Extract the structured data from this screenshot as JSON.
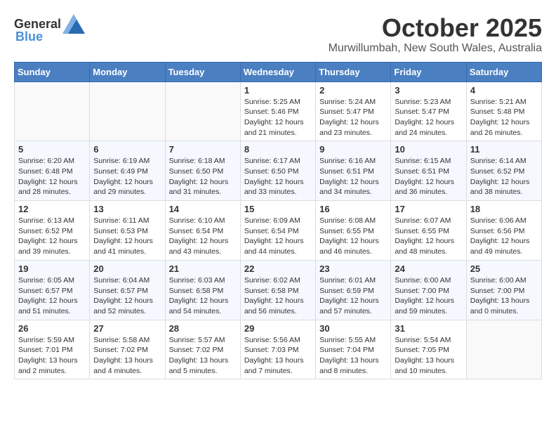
{
  "logo": {
    "general": "General",
    "blue": "Blue"
  },
  "title": "October 2025",
  "location": "Murwillumbah, New South Wales, Australia",
  "weekdays": [
    "Sunday",
    "Monday",
    "Tuesday",
    "Wednesday",
    "Thursday",
    "Friday",
    "Saturday"
  ],
  "weeks": [
    [
      {
        "day": "",
        "info": ""
      },
      {
        "day": "",
        "info": ""
      },
      {
        "day": "",
        "info": ""
      },
      {
        "day": "1",
        "info": "Sunrise: 5:25 AM\nSunset: 5:46 PM\nDaylight: 12 hours\nand 21 minutes."
      },
      {
        "day": "2",
        "info": "Sunrise: 5:24 AM\nSunset: 5:47 PM\nDaylight: 12 hours\nand 23 minutes."
      },
      {
        "day": "3",
        "info": "Sunrise: 5:23 AM\nSunset: 5:47 PM\nDaylight: 12 hours\nand 24 minutes."
      },
      {
        "day": "4",
        "info": "Sunrise: 5:21 AM\nSunset: 5:48 PM\nDaylight: 12 hours\nand 26 minutes."
      }
    ],
    [
      {
        "day": "5",
        "info": "Sunrise: 6:20 AM\nSunset: 6:48 PM\nDaylight: 12 hours\nand 28 minutes."
      },
      {
        "day": "6",
        "info": "Sunrise: 6:19 AM\nSunset: 6:49 PM\nDaylight: 12 hours\nand 29 minutes."
      },
      {
        "day": "7",
        "info": "Sunrise: 6:18 AM\nSunset: 6:50 PM\nDaylight: 12 hours\nand 31 minutes."
      },
      {
        "day": "8",
        "info": "Sunrise: 6:17 AM\nSunset: 6:50 PM\nDaylight: 12 hours\nand 33 minutes."
      },
      {
        "day": "9",
        "info": "Sunrise: 6:16 AM\nSunset: 6:51 PM\nDaylight: 12 hours\nand 34 minutes."
      },
      {
        "day": "10",
        "info": "Sunrise: 6:15 AM\nSunset: 6:51 PM\nDaylight: 12 hours\nand 36 minutes."
      },
      {
        "day": "11",
        "info": "Sunrise: 6:14 AM\nSunset: 6:52 PM\nDaylight: 12 hours\nand 38 minutes."
      }
    ],
    [
      {
        "day": "12",
        "info": "Sunrise: 6:13 AM\nSunset: 6:52 PM\nDaylight: 12 hours\nand 39 minutes."
      },
      {
        "day": "13",
        "info": "Sunrise: 6:11 AM\nSunset: 6:53 PM\nDaylight: 12 hours\nand 41 minutes."
      },
      {
        "day": "14",
        "info": "Sunrise: 6:10 AM\nSunset: 6:54 PM\nDaylight: 12 hours\nand 43 minutes."
      },
      {
        "day": "15",
        "info": "Sunrise: 6:09 AM\nSunset: 6:54 PM\nDaylight: 12 hours\nand 44 minutes."
      },
      {
        "day": "16",
        "info": "Sunrise: 6:08 AM\nSunset: 6:55 PM\nDaylight: 12 hours\nand 46 minutes."
      },
      {
        "day": "17",
        "info": "Sunrise: 6:07 AM\nSunset: 6:55 PM\nDaylight: 12 hours\nand 48 minutes."
      },
      {
        "day": "18",
        "info": "Sunrise: 6:06 AM\nSunset: 6:56 PM\nDaylight: 12 hours\nand 49 minutes."
      }
    ],
    [
      {
        "day": "19",
        "info": "Sunrise: 6:05 AM\nSunset: 6:57 PM\nDaylight: 12 hours\nand 51 minutes."
      },
      {
        "day": "20",
        "info": "Sunrise: 6:04 AM\nSunset: 6:57 PM\nDaylight: 12 hours\nand 52 minutes."
      },
      {
        "day": "21",
        "info": "Sunrise: 6:03 AM\nSunset: 6:58 PM\nDaylight: 12 hours\nand 54 minutes."
      },
      {
        "day": "22",
        "info": "Sunrise: 6:02 AM\nSunset: 6:58 PM\nDaylight: 12 hours\nand 56 minutes."
      },
      {
        "day": "23",
        "info": "Sunrise: 6:01 AM\nSunset: 6:59 PM\nDaylight: 12 hours\nand 57 minutes."
      },
      {
        "day": "24",
        "info": "Sunrise: 6:00 AM\nSunset: 7:00 PM\nDaylight: 12 hours\nand 59 minutes."
      },
      {
        "day": "25",
        "info": "Sunrise: 6:00 AM\nSunset: 7:00 PM\nDaylight: 13 hours\nand 0 minutes."
      }
    ],
    [
      {
        "day": "26",
        "info": "Sunrise: 5:59 AM\nSunset: 7:01 PM\nDaylight: 13 hours\nand 2 minutes."
      },
      {
        "day": "27",
        "info": "Sunrise: 5:58 AM\nSunset: 7:02 PM\nDaylight: 13 hours\nand 4 minutes."
      },
      {
        "day": "28",
        "info": "Sunrise: 5:57 AM\nSunset: 7:02 PM\nDaylight: 13 hours\nand 5 minutes."
      },
      {
        "day": "29",
        "info": "Sunrise: 5:56 AM\nSunset: 7:03 PM\nDaylight: 13 hours\nand 7 minutes."
      },
      {
        "day": "30",
        "info": "Sunrise: 5:55 AM\nSunset: 7:04 PM\nDaylight: 13 hours\nand 8 minutes."
      },
      {
        "day": "31",
        "info": "Sunrise: 5:54 AM\nSunset: 7:05 PM\nDaylight: 13 hours\nand 10 minutes."
      },
      {
        "day": "",
        "info": ""
      }
    ]
  ]
}
